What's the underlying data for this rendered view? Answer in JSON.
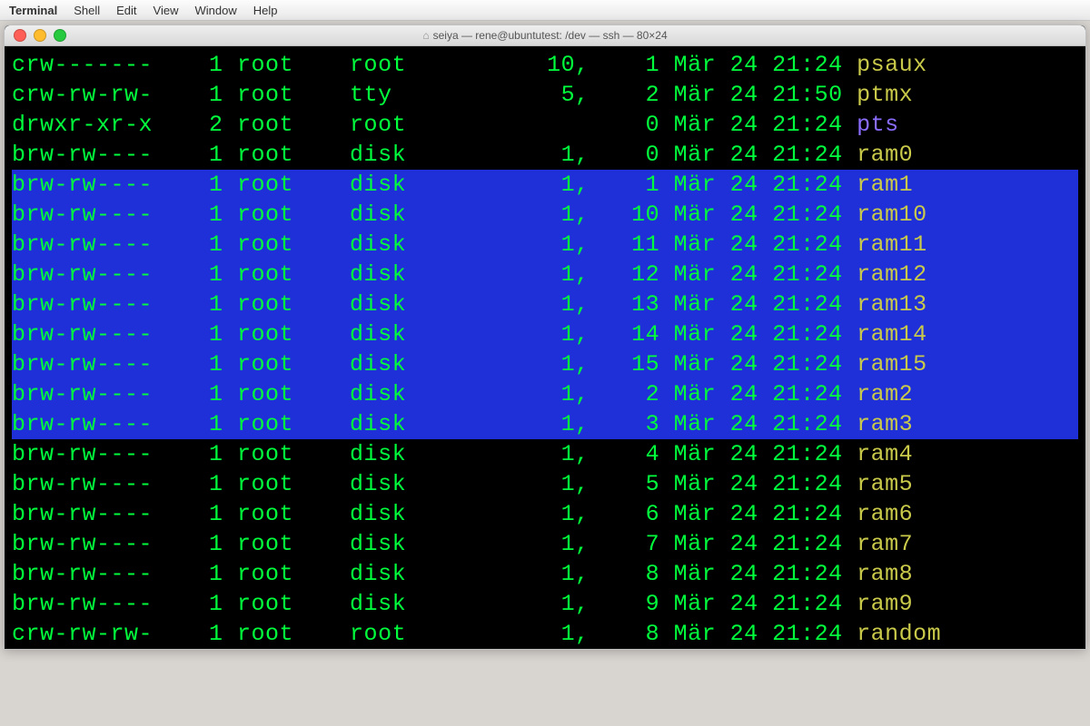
{
  "menu": {
    "app": "Terminal",
    "items": [
      "Shell",
      "Edit",
      "View",
      "Window",
      "Help"
    ]
  },
  "window": {
    "title": "seiya — rene@ubuntutest: /dev — ssh — 80×24"
  },
  "colors": {
    "green": "#00ff3c",
    "yellow": "#c9c94a",
    "purple": "#8a6cff",
    "selection": "#2030d8"
  },
  "cols": {
    "perm": 10,
    "links": 5,
    "owner": 8,
    "group": 9,
    "major": 8,
    "minor": 5,
    "mon": 4,
    "day": 3,
    "time": 6
  },
  "rows": [
    {
      "perm": "crw-------",
      "links": "1",
      "owner": "root",
      "group": "root",
      "major": "10,",
      "minor": "1",
      "mon": "Mär",
      "day": "24",
      "time": "21:24",
      "name": "psaux",
      "ncolor": "yellow",
      "sel": false
    },
    {
      "perm": "crw-rw-rw-",
      "links": "1",
      "owner": "root",
      "group": "tty",
      "major": "5,",
      "minor": "2",
      "mon": "Mär",
      "day": "24",
      "time": "21:50",
      "name": "ptmx",
      "ncolor": "yellow",
      "sel": false
    },
    {
      "perm": "drwxr-xr-x",
      "links": "2",
      "owner": "root",
      "group": "root",
      "major": "",
      "minor": "0",
      "mon": "Mär",
      "day": "24",
      "time": "21:24",
      "name": "pts",
      "ncolor": "purple",
      "sel": false
    },
    {
      "perm": "brw-rw----",
      "links": "1",
      "owner": "root",
      "group": "disk",
      "major": "1,",
      "minor": "0",
      "mon": "Mär",
      "day": "24",
      "time": "21:24",
      "name": "ram0",
      "ncolor": "yellow",
      "sel": false
    },
    {
      "perm": "brw-rw----",
      "links": "1",
      "owner": "root",
      "group": "disk",
      "major": "1,",
      "minor": "1",
      "mon": "Mär",
      "day": "24",
      "time": "21:24",
      "name": "ram1",
      "ncolor": "yellow",
      "sel": true
    },
    {
      "perm": "brw-rw----",
      "links": "1",
      "owner": "root",
      "group": "disk",
      "major": "1,",
      "minor": "10",
      "mon": "Mär",
      "day": "24",
      "time": "21:24",
      "name": "ram10",
      "ncolor": "yellow",
      "sel": true
    },
    {
      "perm": "brw-rw----",
      "links": "1",
      "owner": "root",
      "group": "disk",
      "major": "1,",
      "minor": "11",
      "mon": "Mär",
      "day": "24",
      "time": "21:24",
      "name": "ram11",
      "ncolor": "yellow",
      "sel": true
    },
    {
      "perm": "brw-rw----",
      "links": "1",
      "owner": "root",
      "group": "disk",
      "major": "1,",
      "minor": "12",
      "mon": "Mär",
      "day": "24",
      "time": "21:24",
      "name": "ram12",
      "ncolor": "yellow",
      "sel": true
    },
    {
      "perm": "brw-rw----",
      "links": "1",
      "owner": "root",
      "group": "disk",
      "major": "1,",
      "minor": "13",
      "mon": "Mär",
      "day": "24",
      "time": "21:24",
      "name": "ram13",
      "ncolor": "yellow",
      "sel": true
    },
    {
      "perm": "brw-rw----",
      "links": "1",
      "owner": "root",
      "group": "disk",
      "major": "1,",
      "minor": "14",
      "mon": "Mär",
      "day": "24",
      "time": "21:24",
      "name": "ram14",
      "ncolor": "yellow",
      "sel": true
    },
    {
      "perm": "brw-rw----",
      "links": "1",
      "owner": "root",
      "group": "disk",
      "major": "1,",
      "minor": "15",
      "mon": "Mär",
      "day": "24",
      "time": "21:24",
      "name": "ram15",
      "ncolor": "yellow",
      "sel": true
    },
    {
      "perm": "brw-rw----",
      "links": "1",
      "owner": "root",
      "group": "disk",
      "major": "1,",
      "minor": "2",
      "mon": "Mär",
      "day": "24",
      "time": "21:24",
      "name": "ram2",
      "ncolor": "yellow",
      "sel": true
    },
    {
      "perm": "brw-rw----",
      "links": "1",
      "owner": "root",
      "group": "disk",
      "major": "1,",
      "minor": "3",
      "mon": "Mär",
      "day": "24",
      "time": "21:24",
      "name": "ram3",
      "ncolor": "yellow",
      "sel": true
    },
    {
      "perm": "brw-rw----",
      "links": "1",
      "owner": "root",
      "group": "disk",
      "major": "1,",
      "minor": "4",
      "mon": "Mär",
      "day": "24",
      "time": "21:24",
      "name": "ram4",
      "ncolor": "yellow",
      "sel": false
    },
    {
      "perm": "brw-rw----",
      "links": "1",
      "owner": "root",
      "group": "disk",
      "major": "1,",
      "minor": "5",
      "mon": "Mär",
      "day": "24",
      "time": "21:24",
      "name": "ram5",
      "ncolor": "yellow",
      "sel": false
    },
    {
      "perm": "brw-rw----",
      "links": "1",
      "owner": "root",
      "group": "disk",
      "major": "1,",
      "minor": "6",
      "mon": "Mär",
      "day": "24",
      "time": "21:24",
      "name": "ram6",
      "ncolor": "yellow",
      "sel": false
    },
    {
      "perm": "brw-rw----",
      "links": "1",
      "owner": "root",
      "group": "disk",
      "major": "1,",
      "minor": "7",
      "mon": "Mär",
      "day": "24",
      "time": "21:24",
      "name": "ram7",
      "ncolor": "yellow",
      "sel": false
    },
    {
      "perm": "brw-rw----",
      "links": "1",
      "owner": "root",
      "group": "disk",
      "major": "1,",
      "minor": "8",
      "mon": "Mär",
      "day": "24",
      "time": "21:24",
      "name": "ram8",
      "ncolor": "yellow",
      "sel": false
    },
    {
      "perm": "brw-rw----",
      "links": "1",
      "owner": "root",
      "group": "disk",
      "major": "1,",
      "minor": "9",
      "mon": "Mär",
      "day": "24",
      "time": "21:24",
      "name": "ram9",
      "ncolor": "yellow",
      "sel": false
    },
    {
      "perm": "crw-rw-rw-",
      "links": "1",
      "owner": "root",
      "group": "root",
      "major": "1,",
      "minor": "8",
      "mon": "Mär",
      "day": "24",
      "time": "21:24",
      "name": "random",
      "ncolor": "yellow",
      "sel": false
    }
  ]
}
